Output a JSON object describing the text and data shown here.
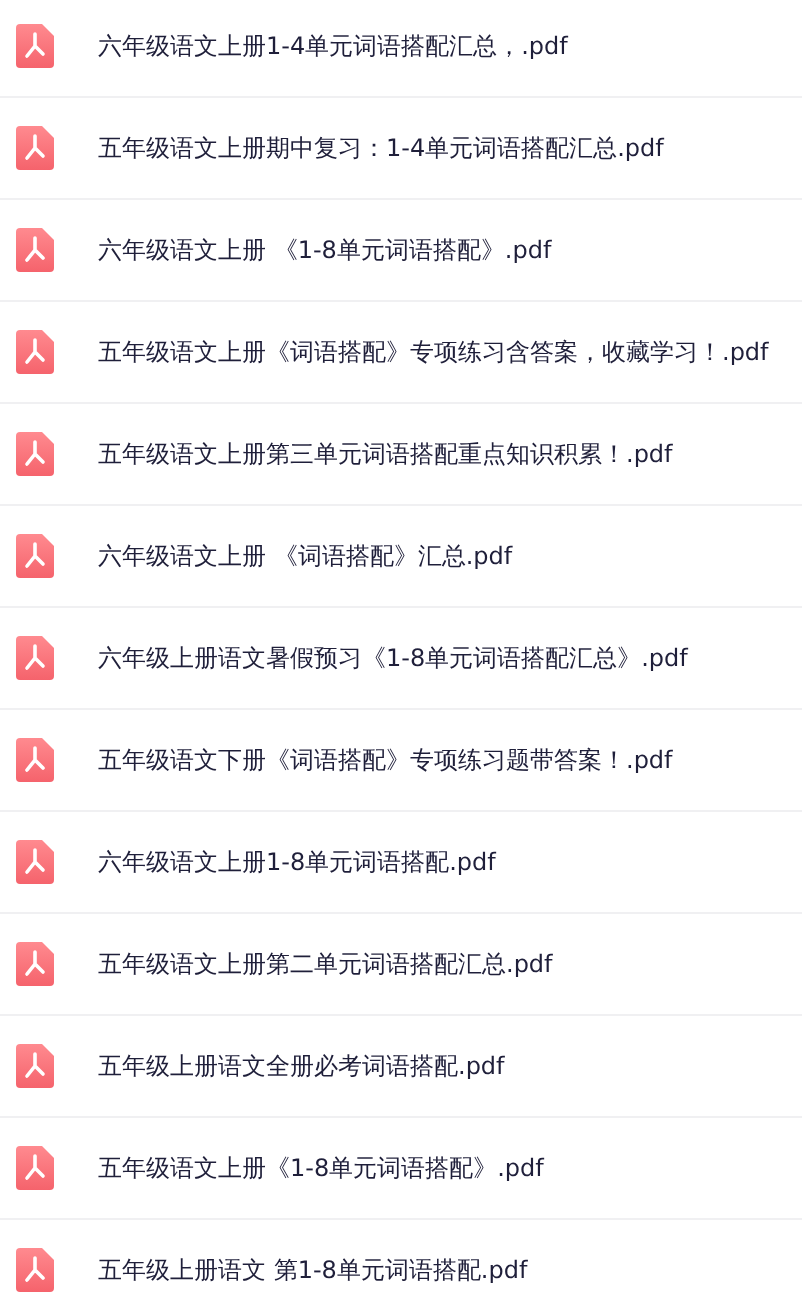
{
  "files": [
    {
      "name": "六年级语文上册1-4单元词语搭配汇总，.pdf"
    },
    {
      "name": "五年级语文上册期中复习：1-4单元词语搭配汇总.pdf"
    },
    {
      "name": "六年级语文上册 《1-8单元词语搭配》.pdf"
    },
    {
      "name": "五年级语文上册《词语搭配》专项练习含答案，收藏学习！.pdf"
    },
    {
      "name": "五年级语文上册第三单元词语搭配重点知识积累！.pdf"
    },
    {
      "name": "六年级语文上册 《词语搭配》汇总.pdf"
    },
    {
      "name": "六年级上册语文暑假预习《1-8单元词语搭配汇总》.pdf"
    },
    {
      "name": "五年级语文下册《词语搭配》专项练习题带答案！.pdf"
    },
    {
      "name": "六年级语文上册1-8单元词语搭配.pdf"
    },
    {
      "name": "五年级语文上册第二单元词语搭配汇总.pdf"
    },
    {
      "name": "五年级上册语文全册必考词语搭配.pdf"
    },
    {
      "name": "五年级语文上册《1-8单元词语搭配》.pdf"
    },
    {
      "name": "五年级上册语文 第1-8单元词语搭配.pdf"
    }
  ]
}
